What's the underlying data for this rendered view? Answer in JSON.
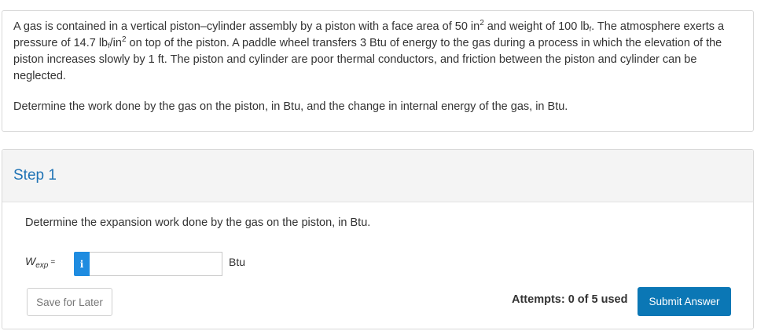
{
  "problem": {
    "p1_a": "A gas is contained in a vertical piston–cylinder assembly by a piston with a face area of 50 in",
    "p1_sup1": "2",
    "p1_b": " and weight of 100 lb",
    "p1_sub1": "f",
    "p1_c": ". The atmosphere exerts a pressure of 14.7 lb",
    "p1_sub2": "f",
    "p1_d": "/in",
    "p1_sup2": "2",
    "p1_e": " on top of the piston. A paddle wheel transfers 3 Btu of energy to the gas during a process in which the elevation of the piston increases slowly by 1 ft. The piston and cylinder are poor thermal conductors, and friction between the piston and cylinder can be neglected.",
    "question": "Determine the work done by the gas on the piston, in Btu, and the change in internal energy of the gas, in Btu."
  },
  "step": {
    "title": "Step 1",
    "prompt": "Determine the expansion work done by the gas on the piston, in Btu.",
    "var_symbol": "W",
    "var_subscript": "exp",
    "equals": "=",
    "info_icon_glyph": "i",
    "input_value": "",
    "unit": "Btu",
    "save_label": "Save for Later",
    "attempts_text": "Attempts: 0 of 5 used",
    "submit_label": "Submit Answer"
  },
  "colors": {
    "accent": "#1f73b5",
    "submit_bg": "#0b77b5",
    "info_bg": "#1f8ce0"
  }
}
